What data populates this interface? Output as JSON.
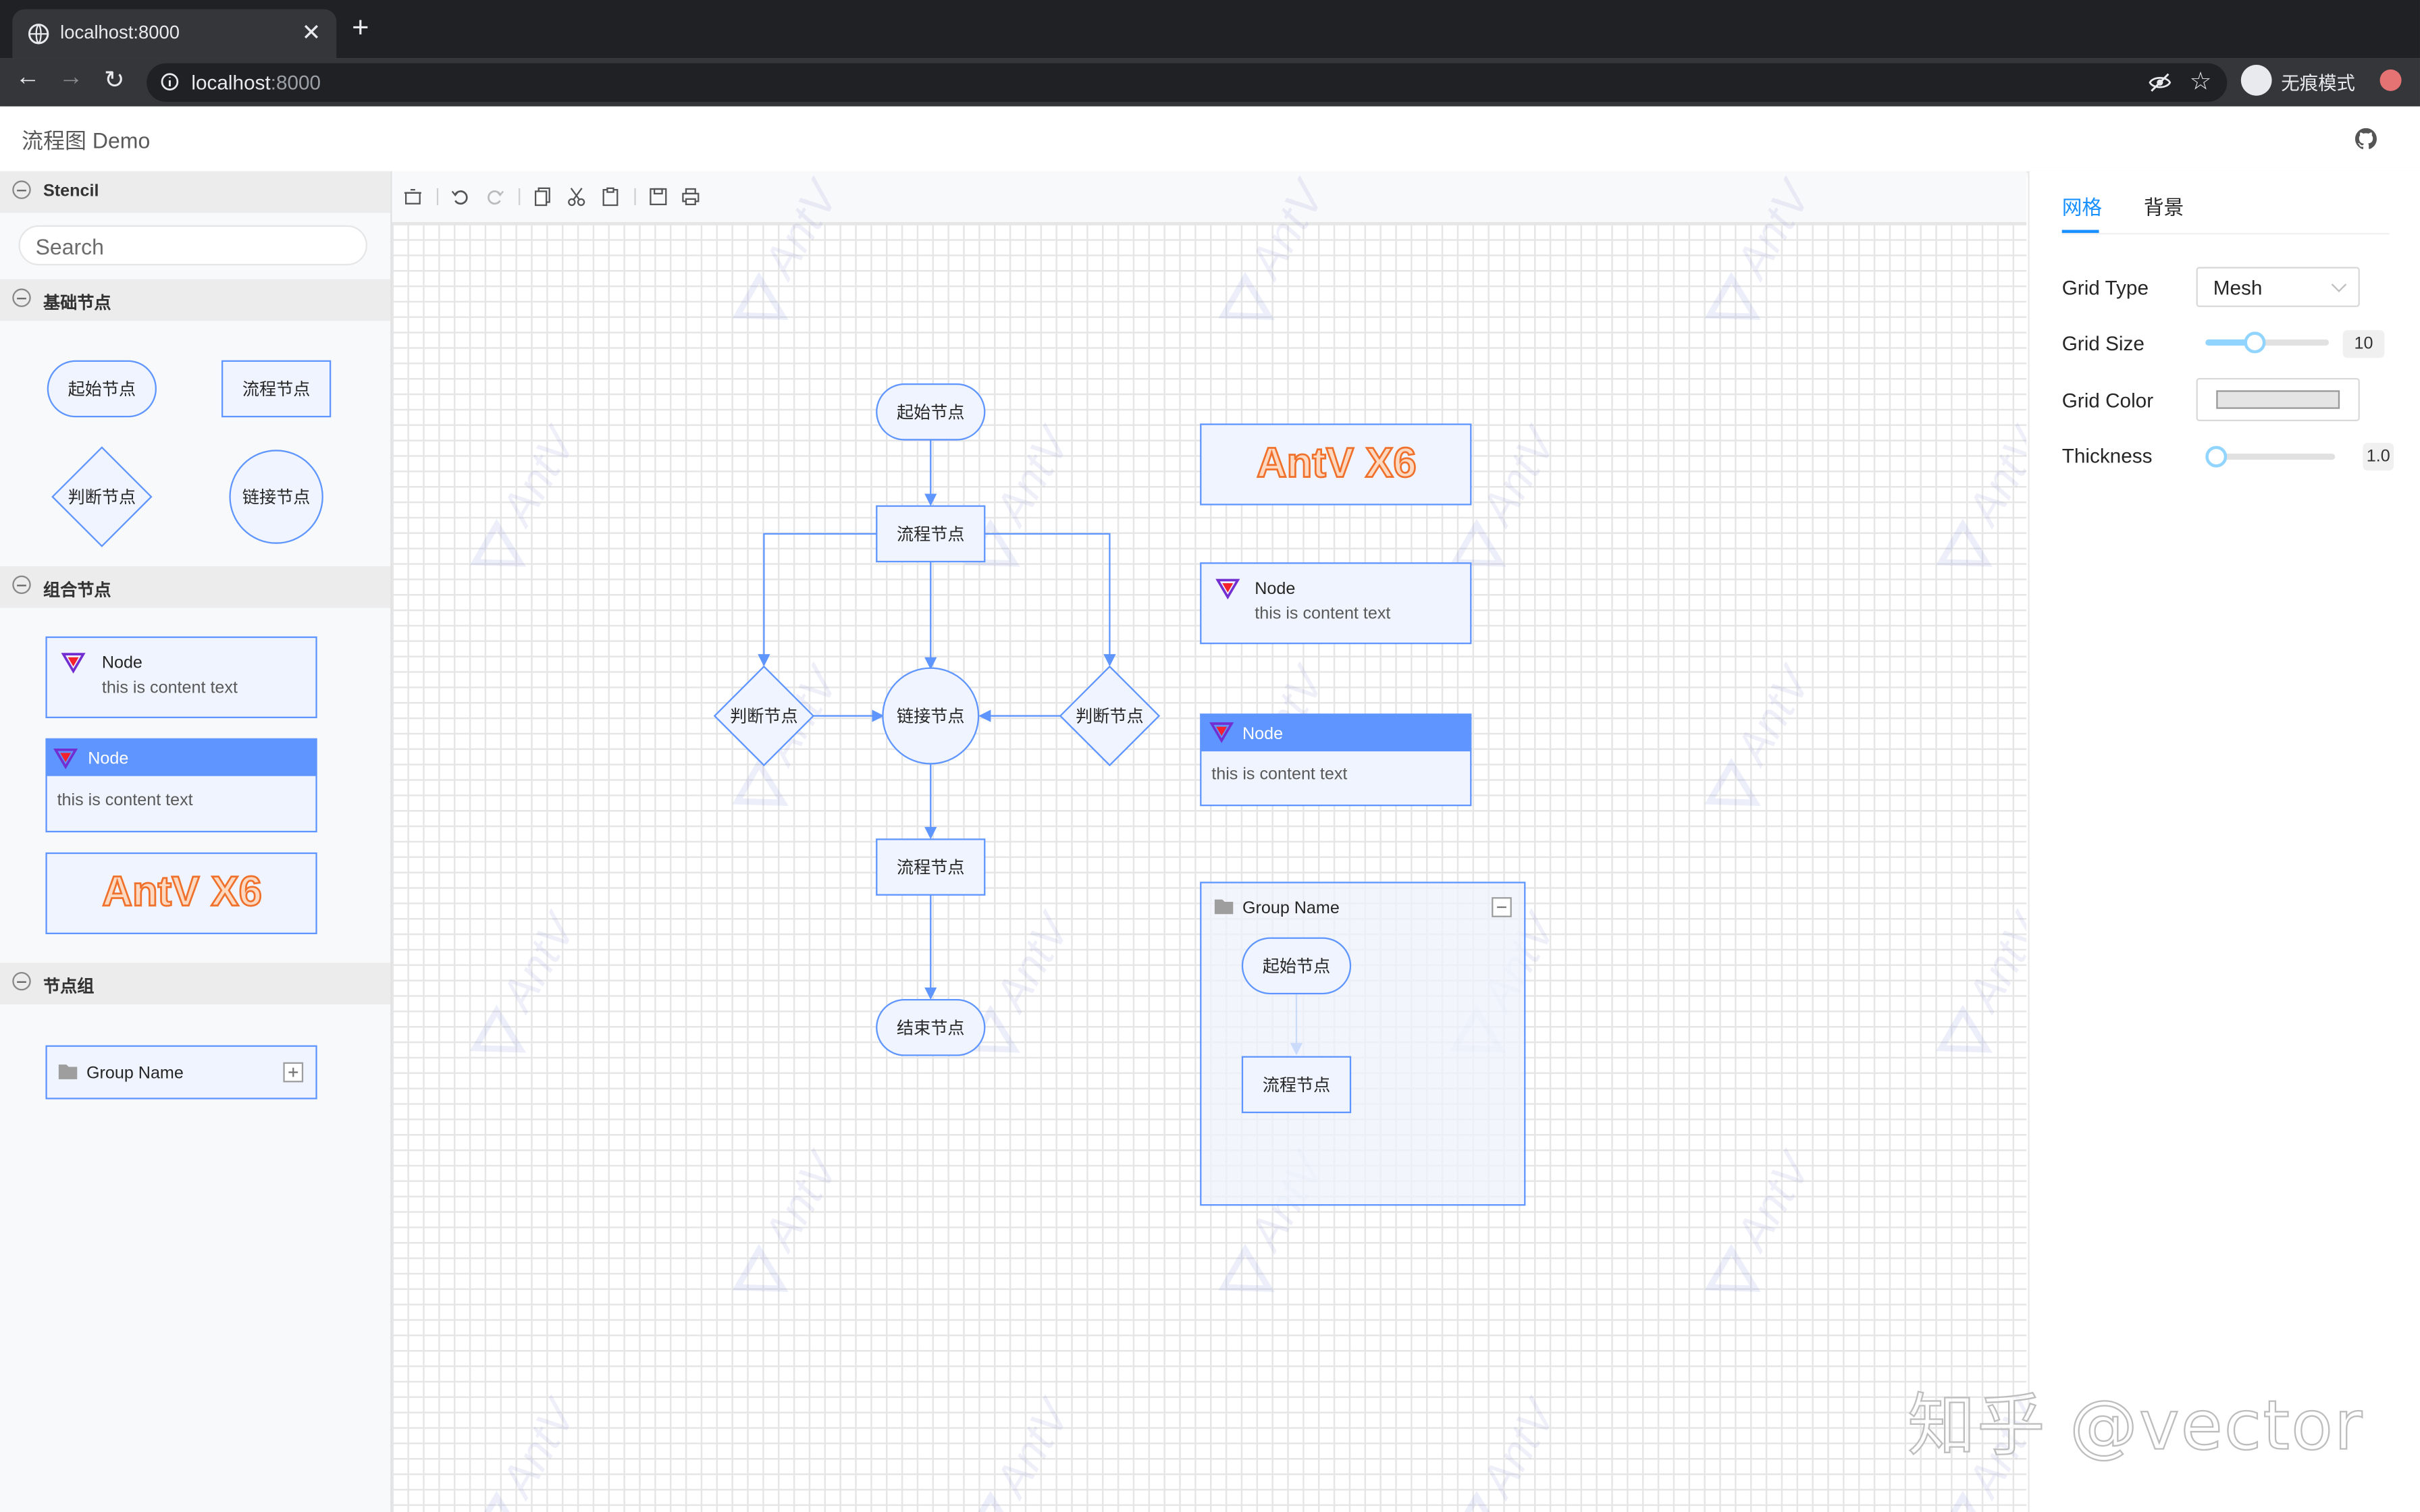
{
  "browser": {
    "tab_title": "localhost:8000",
    "url_host": "localhost",
    "url_port": ":8000",
    "incognito_label": "无痕模式"
  },
  "app": {
    "title": "流程图 Demo"
  },
  "stencil": {
    "header": "Stencil",
    "search_placeholder": "Search",
    "groups": [
      {
        "title": "基础节点",
        "items": [
          "起始节点",
          "流程节点",
          "判断节点",
          "链接节点"
        ]
      },
      {
        "title": "组合节点",
        "items": [
          {
            "title": "Node",
            "content": "this is content text"
          },
          {
            "title": "Node",
            "content": "this is content text"
          },
          {
            "title": "AntV X6"
          }
        ]
      },
      {
        "title": "节点组",
        "items": [
          {
            "title": "Group Name"
          }
        ]
      }
    ]
  },
  "canvas": {
    "watermark": "AntV",
    "nodes": {
      "start": "起始节点",
      "process_top": "流程节点",
      "decision_left": "判断节点",
      "link": "链接节点",
      "decision_right": "判断节点",
      "process_bottom": "流程节点",
      "end": "结束节点",
      "logo_node": "AntV X6",
      "card1_title": "Node",
      "card1_content": "this is content text",
      "card2_title": "Node",
      "card2_content": "this is content text",
      "group_title": "Group Name",
      "group_start": "起始节点",
      "group_process": "流程节点"
    }
  },
  "config": {
    "tabs": [
      "网格",
      "背景"
    ],
    "active_tab": 0,
    "grid_type_label": "Grid Type",
    "grid_type_value": "Mesh",
    "grid_size_label": "Grid Size",
    "grid_size_value": "10",
    "grid_size_fraction": 0.4,
    "grid_color_label": "Grid Color",
    "grid_color_value": "#e5e5e5",
    "thickness_label": "Thickness",
    "thickness_value": "1.0",
    "thickness_fraction": 0.0
  },
  "overlay_watermark": "知乎 @vector",
  "colors": {
    "node_stroke": "#5f95ff",
    "node_fill": "#eff4ff",
    "edge": "#5f95ff",
    "card_header": "#5f95ff",
    "logo_text": "#f28b4c",
    "accent": "#1890ff"
  }
}
